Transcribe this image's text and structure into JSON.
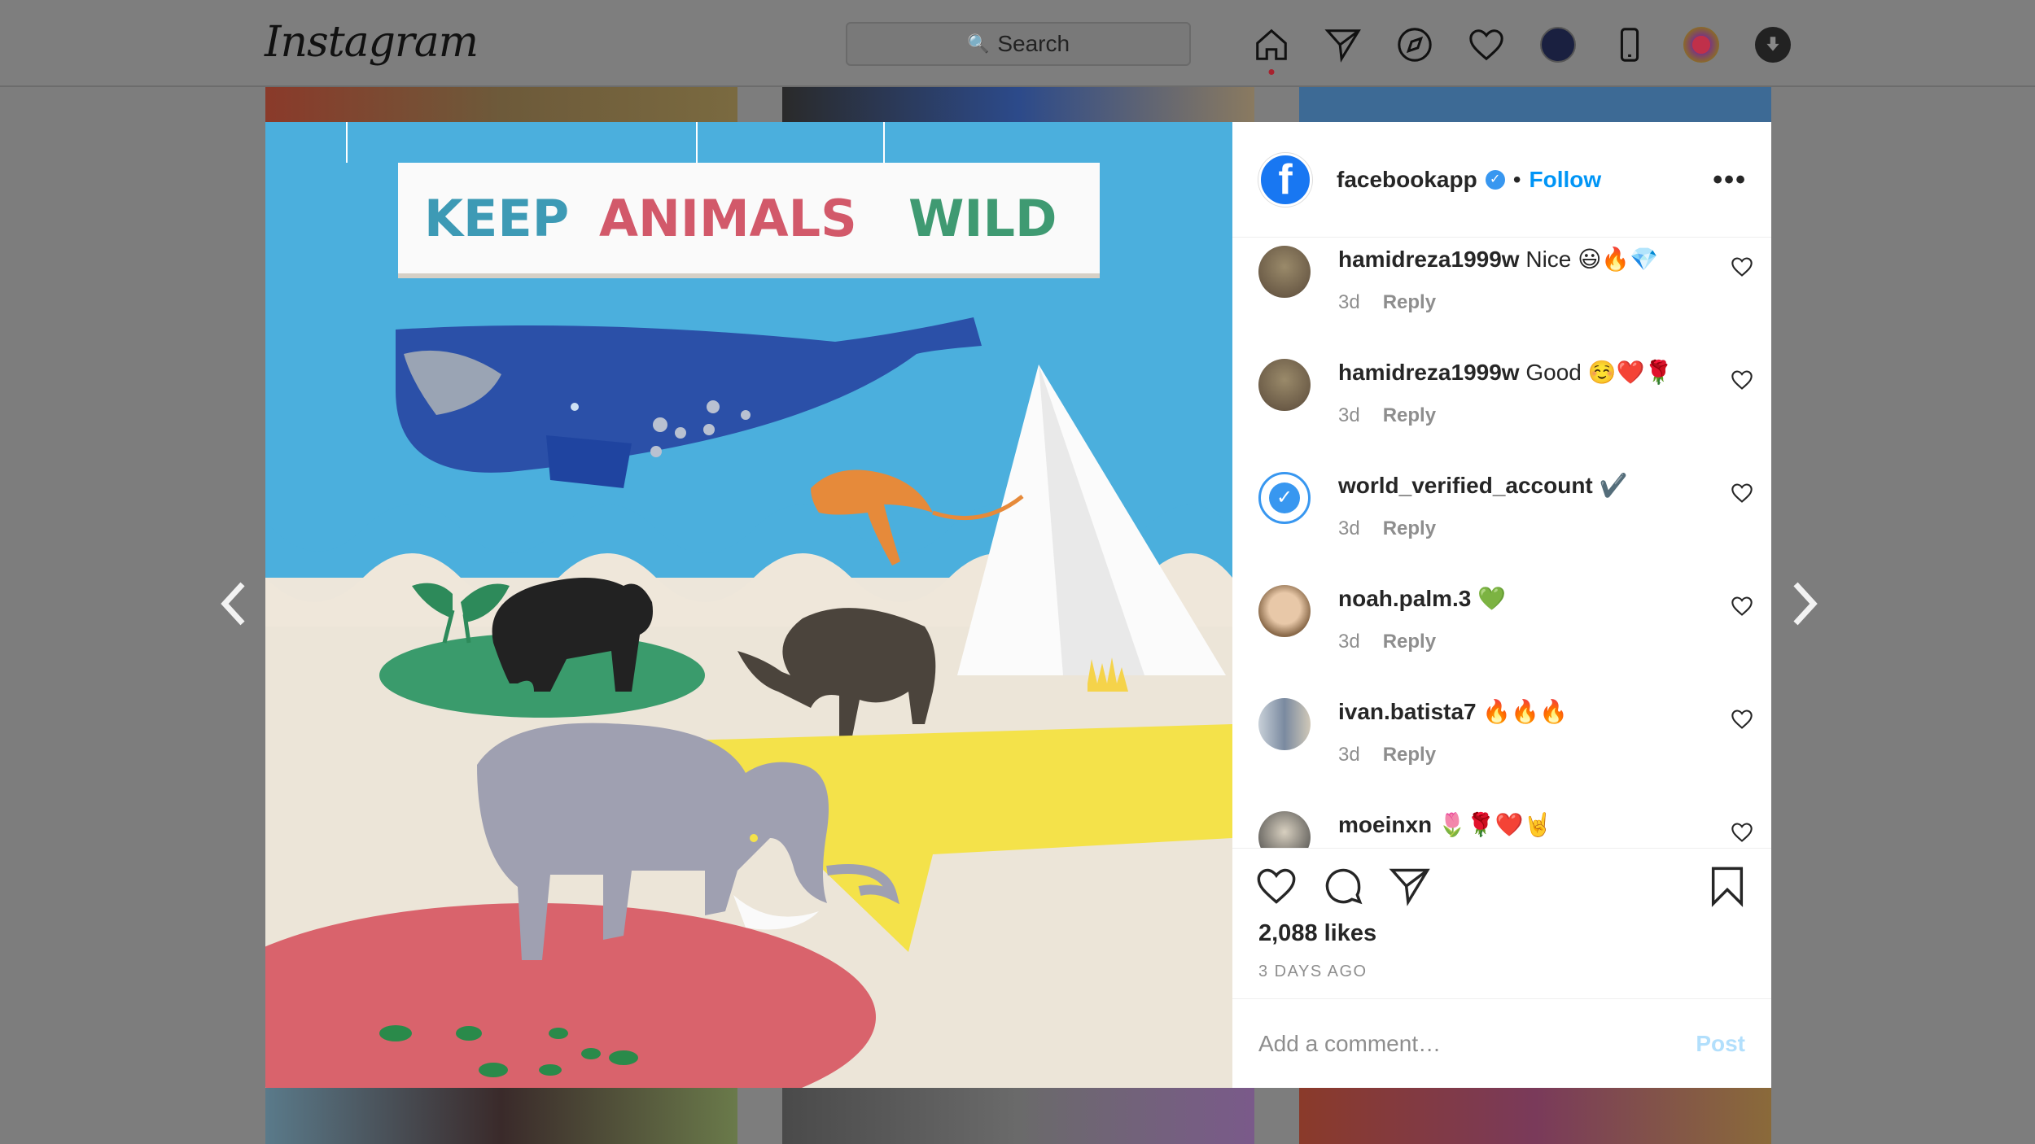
{
  "nav": {
    "logo": "Instagram",
    "search_placeholder": "Search",
    "icons": [
      "home-icon",
      "direct-icon",
      "explore-icon",
      "activity-icon",
      "profile-avatar",
      "phone-icon",
      "extension-icon",
      "download-icon"
    ]
  },
  "post": {
    "image_title": {
      "word1": "KEEP",
      "word2": "ANIMALS",
      "word3": "WILD"
    },
    "author": {
      "username": "facebookapp",
      "follow_label": "Follow",
      "separator": "•"
    },
    "comments": [
      {
        "user": "hamidreza1999w",
        "text": "Nice 😃🔥💎",
        "time": "3d",
        "reply": "Reply"
      },
      {
        "user": "hamidreza1999w",
        "text": "Good ☺️❤️🌹",
        "time": "3d",
        "reply": "Reply"
      },
      {
        "user": "world_verified_account",
        "text": "✔️",
        "time": "3d",
        "reply": "Reply"
      },
      {
        "user": "noah.palm.3",
        "text": "💚",
        "time": "3d",
        "reply": "Reply"
      },
      {
        "user": "ivan.batista7",
        "text": "🔥🔥🔥",
        "time": "3d",
        "reply": "Reply"
      },
      {
        "user": "moeinxn",
        "text": "🌷🌹❤️🤘",
        "time": "",
        "reply": ""
      }
    ],
    "likes": "2,088 likes",
    "time_ago": "3 DAYS AGO",
    "add_comment_placeholder": "Add a comment…",
    "post_label": "Post"
  },
  "colors": {
    "follow": "#0095f6",
    "facebook": "#1877f2"
  }
}
